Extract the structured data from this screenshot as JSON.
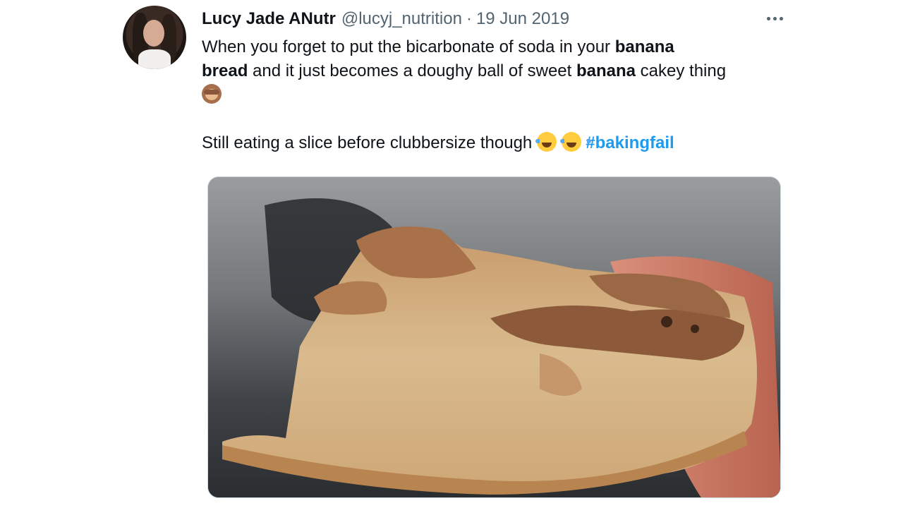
{
  "tweet": {
    "author": {
      "display_name": "Lucy Jade ANutr",
      "handle": "@lucyj_nutrition",
      "avatar_icon": "profile-photo"
    },
    "separator": "·",
    "date": "19 Jun 2019",
    "more_icon": "more-horizontal-icon",
    "text": {
      "line1_pre": "When you forget to put the bicarbonate of soda in your ",
      "bold1": "banana",
      "bold2": "bread",
      "line2_mid": " and it just becomes a doughy ball of sweet ",
      "bold3": "banana",
      "line2_post": " cakey thing",
      "emoji_1": "see-no-evil-monkey-emoji",
      "line3": "Still eating a slice before clubbersize though ",
      "emoji_2": "face-with-tears-of-joy-emoji",
      "hashtag": "#bakingfail"
    },
    "media": {
      "kind": "photo",
      "subject": "banana-bread-slice-photo"
    },
    "colors": {
      "text": "#0f1419",
      "secondary": "#536471",
      "link": "#1d9bf0"
    }
  }
}
